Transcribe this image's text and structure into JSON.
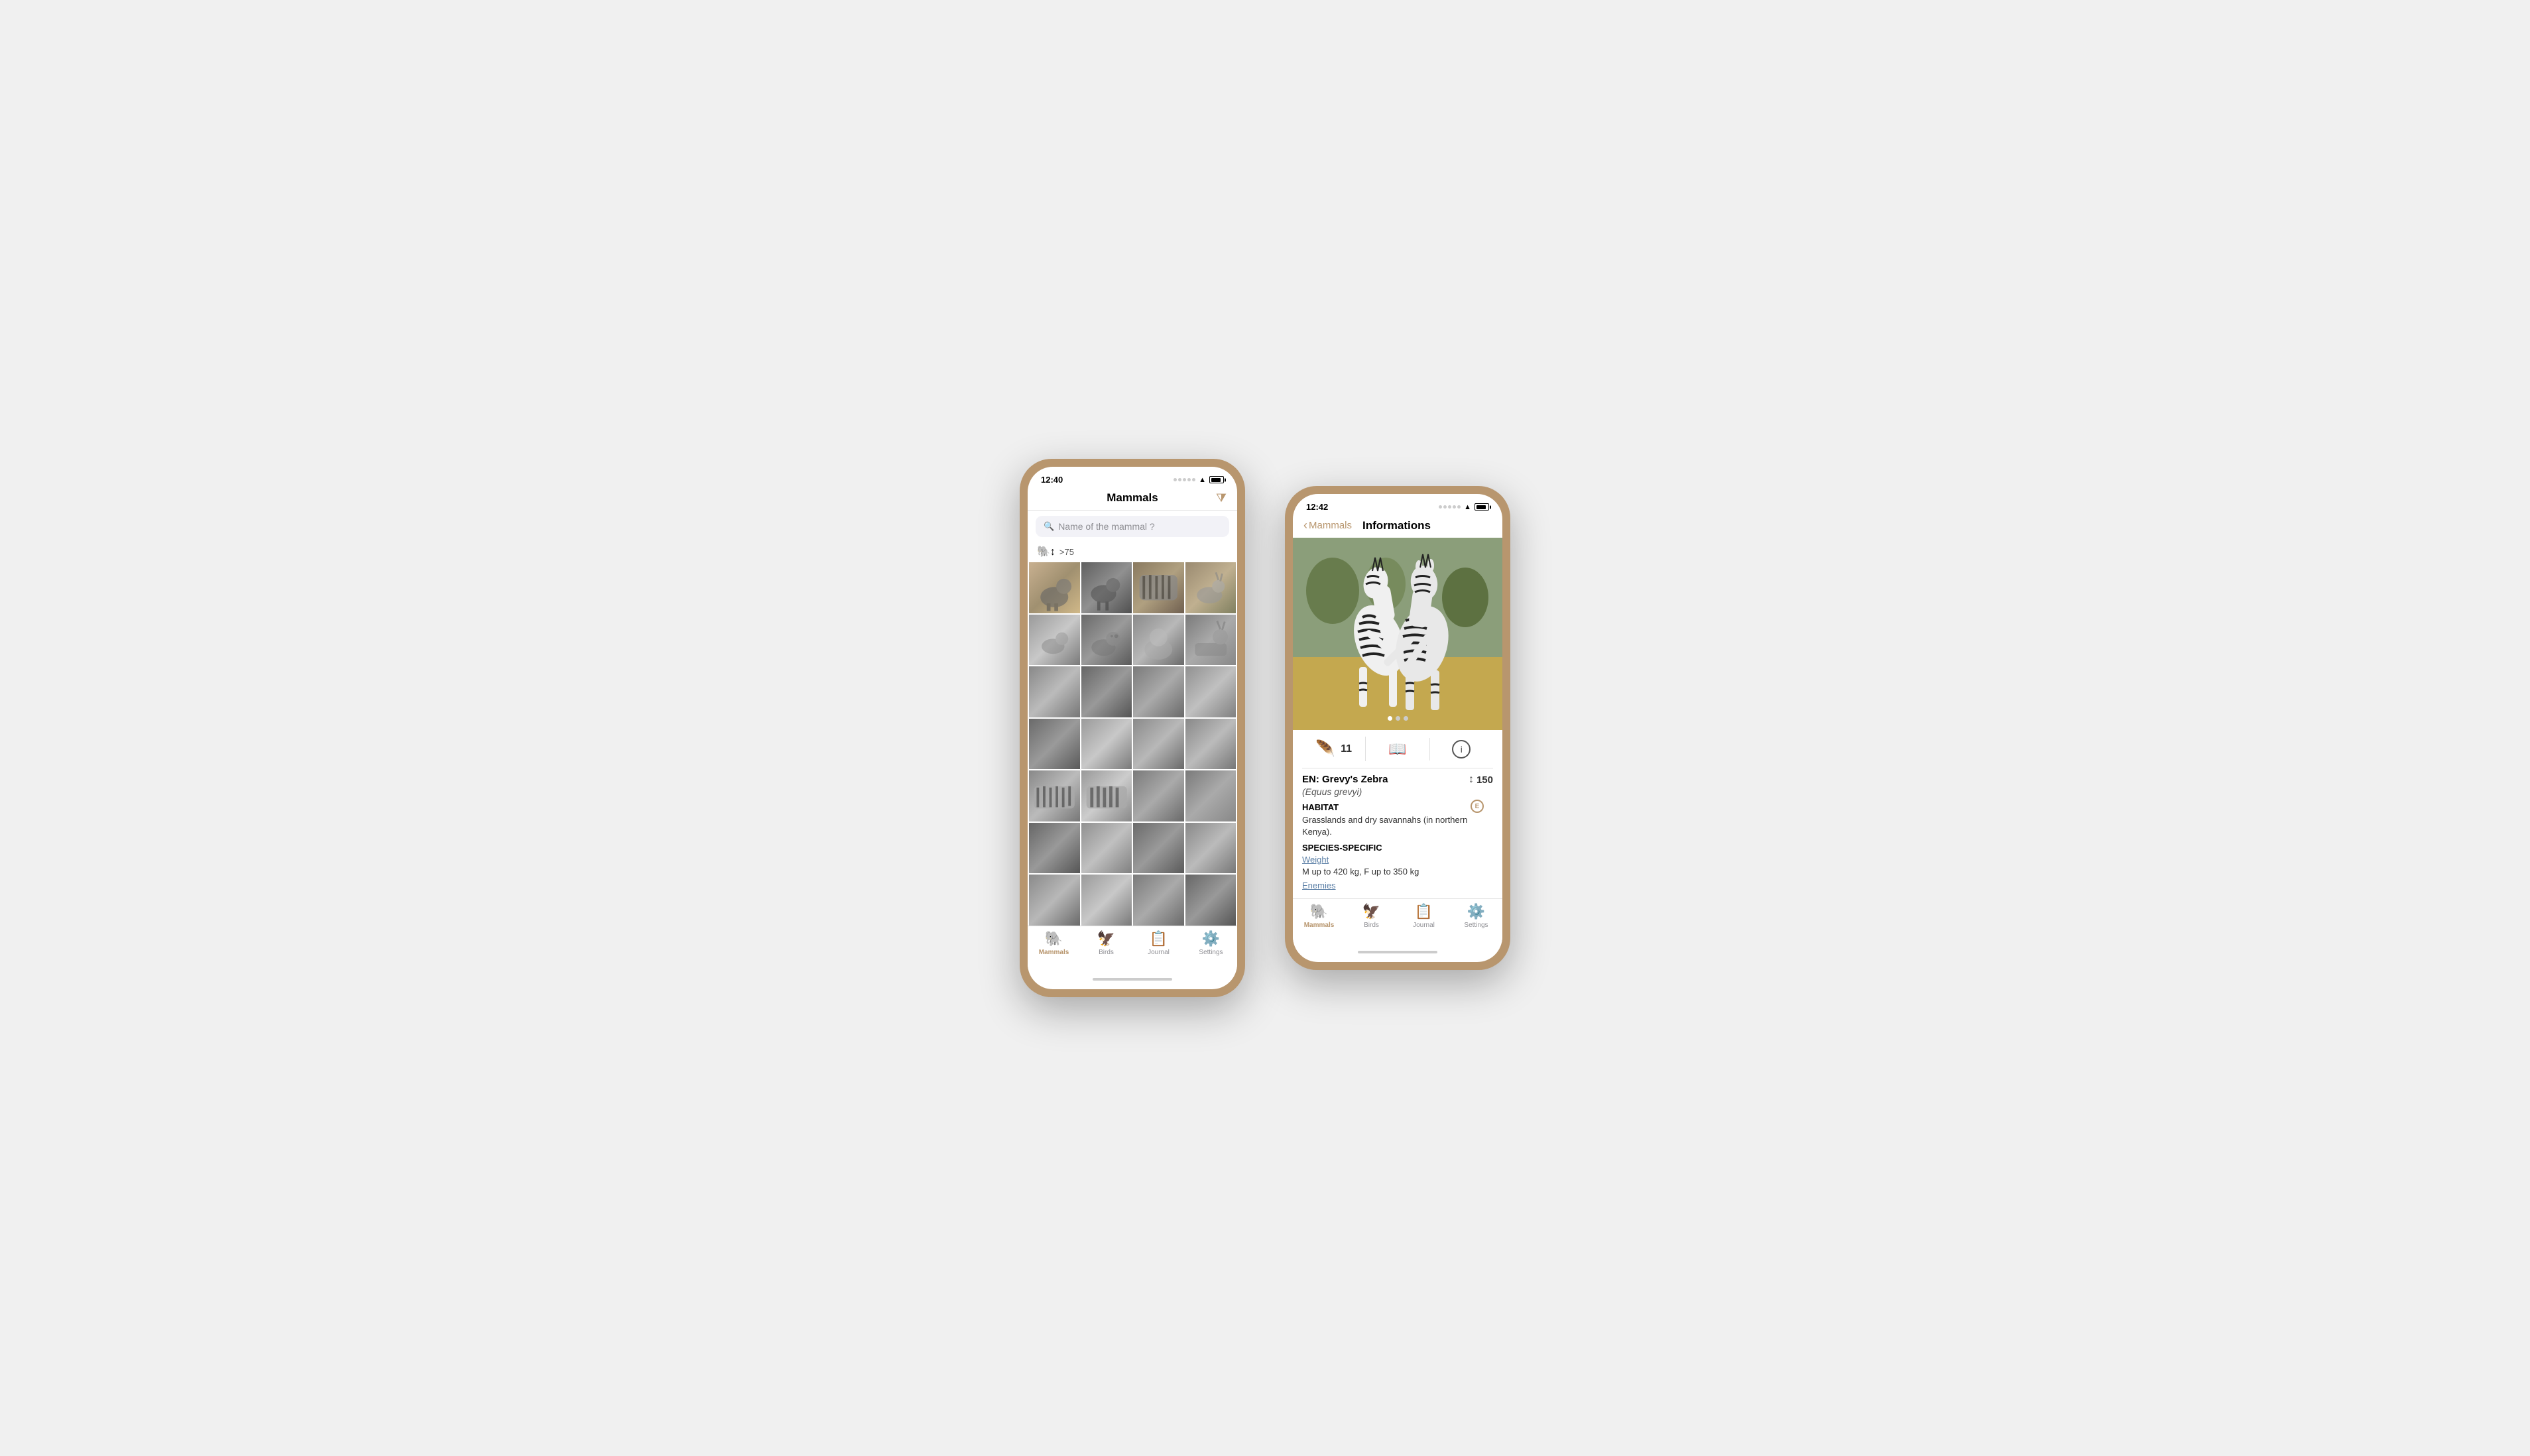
{
  "phone1": {
    "time": "12:40",
    "title": "Mammals",
    "filter_icon": "⧩",
    "search_placeholder": "Name of the mammal ?",
    "count_label": ">75",
    "grid_rows": 7,
    "tabs": [
      {
        "label": "Mammals",
        "icon": "🐘",
        "active": true
      },
      {
        "label": "Birds",
        "icon": "🦅",
        "active": false
      },
      {
        "label": "Journal",
        "icon": "📋",
        "active": false
      },
      {
        "label": "Settings",
        "icon": "⚙️",
        "active": false
      }
    ]
  },
  "phone2": {
    "time": "12:42",
    "back_label": "Mammals",
    "title": "Informations",
    "image_alt": "Two zebras rearing up fighting",
    "icon_row": {
      "feather_count": "11",
      "book_icon": "📖",
      "info_icon": "ℹ"
    },
    "species_en": "EN: Grevy's Zebra",
    "species_count": "150",
    "species_latin": "(Equus grevyi)",
    "endangered_badge": "E",
    "habitat_label": "HABITAT",
    "habitat_text": "Grasslands and dry savannahs (in northern Kenya).",
    "species_specific_label": "SPECIES-SPECIFIC",
    "weight_link": "Weight",
    "weight_text": "M up to 420 kg, F up to 350 kg",
    "enemies_link": "Enemies",
    "tabs": [
      {
        "label": "Mammals",
        "icon": "🐘",
        "active": true
      },
      {
        "label": "Birds",
        "icon": "🦅",
        "active": false
      },
      {
        "label": "Journal",
        "icon": "📋",
        "active": false
      },
      {
        "label": "Settings",
        "icon": "⚙️",
        "active": false
      }
    ]
  }
}
